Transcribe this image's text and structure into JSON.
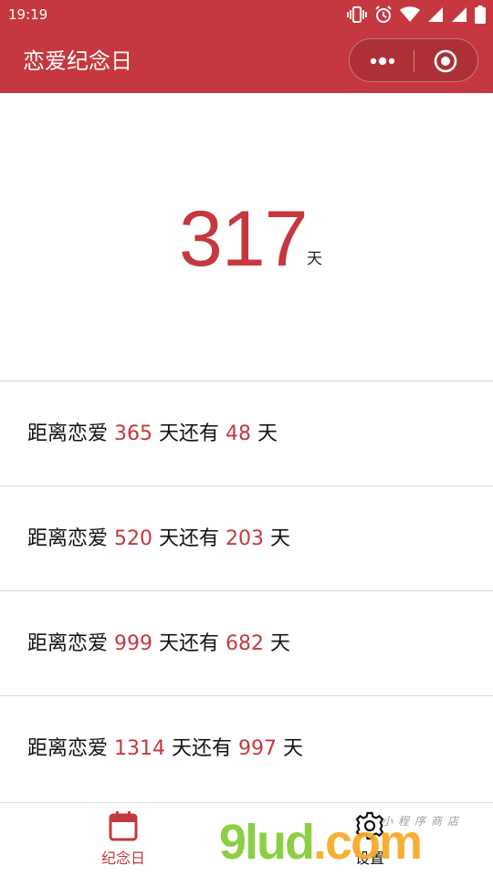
{
  "status_bar": {
    "time": "19:19"
  },
  "nav": {
    "title": "恋爱纪念日"
  },
  "hero": {
    "days": "317",
    "unit": "天"
  },
  "rows": [
    {
      "prefix": "距离恋爱",
      "target": "365",
      "middle": "天还有",
      "remaining": "48",
      "suffix": "天"
    },
    {
      "prefix": "距离恋爱",
      "target": "520",
      "middle": "天还有",
      "remaining": "203",
      "suffix": "天"
    },
    {
      "prefix": "距离恋爱",
      "target": "999",
      "middle": "天还有",
      "remaining": "682",
      "suffix": "天"
    },
    {
      "prefix": "距离恋爱",
      "target": "1314",
      "middle": "天还有",
      "remaining": "997",
      "suffix": "天"
    }
  ],
  "tabbar": {
    "home_label": "纪念日",
    "settings_label": "设置"
  },
  "watermark": {
    "main": "9lud",
    "com": ".com",
    "small": "小程序商店"
  },
  "colors": {
    "accent": "#c6383f",
    "text": "#111111",
    "divider": "#d8d8d8"
  }
}
